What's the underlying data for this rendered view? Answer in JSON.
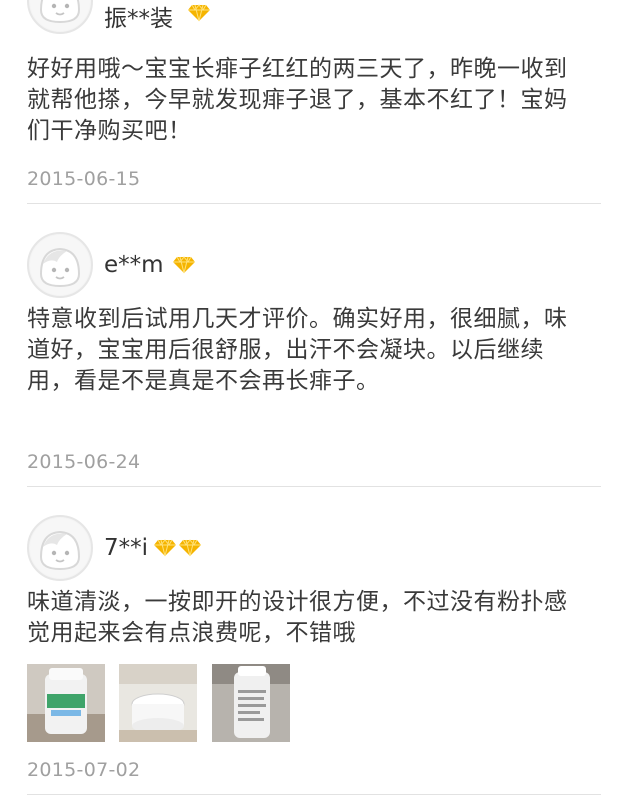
{
  "reviews": [
    {
      "username": "振**装",
      "badge_count": 1,
      "text": "好好用哦～宝宝长痱子红红的两三天了，昨晚一收到就帮他搽，今早就发现痱子退了，基本不红了！宝妈们干净购买吧！",
      "date": "2015-06-15"
    },
    {
      "username": "e**m",
      "badge_count": 1,
      "text": "特意收到后试用几天才评价。确实好用，很细腻，味道好，宝宝用后很舒服，出汗不会凝块。以后继续用，看是不是真是不会再长痱子。",
      "date": "2015-06-24"
    },
    {
      "username": "7**i",
      "badge_count": 2,
      "text": "味道清淡，一按即开的设计很方便，不过没有粉扑感觉用起来会有点浪费呢，不错哦",
      "date": "2015-07-02",
      "photos": [
        "product-photo-1",
        "product-photo-2",
        "product-photo-3"
      ]
    }
  ],
  "colors": {
    "badge": "#f5b400",
    "date": "#a0a0a0",
    "divider": "#e2e2e2",
    "text": "#3a3a3a"
  },
  "icons": {
    "avatar": "default-avatar-icon",
    "badge": "diamond-icon"
  }
}
